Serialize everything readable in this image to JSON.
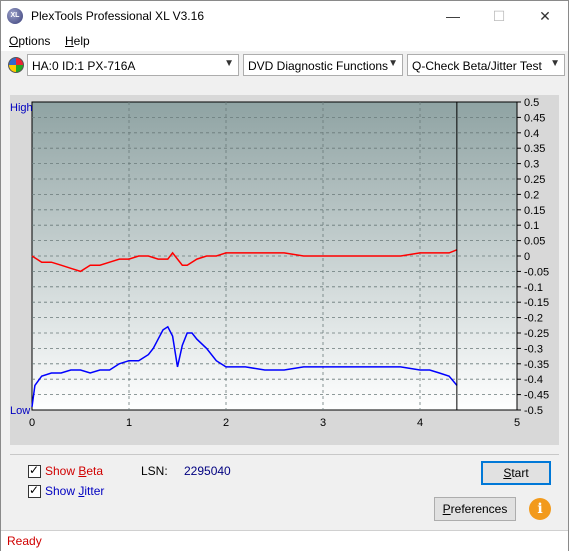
{
  "window": {
    "title": "PlexTools Professional XL V3.16",
    "icon_text": "XL"
  },
  "window_controls": {
    "minimize": "—",
    "maximize": "☐",
    "close": "✕"
  },
  "menu": [
    {
      "label": "Options",
      "ul": "O",
      "rest": "ptions"
    },
    {
      "label": "Help",
      "ul": "H",
      "rest": "elp"
    }
  ],
  "toolbar": {
    "drive": "HA:0 ID:1  PX-716A",
    "function": "DVD Diagnostic Functions",
    "test": "Q-Check Beta/Jitter Test"
  },
  "chart_data": {
    "type": "line",
    "x_ticks": [
      "0",
      "1",
      "2",
      "3",
      "4",
      "5"
    ],
    "xlim": [
      0,
      5
    ],
    "ylim": [
      -0.5,
      0.5
    ],
    "y_right_ticks": [
      "0.5",
      "0.45",
      "0.4",
      "0.35",
      "0.3",
      "0.25",
      "0.2",
      "0.15",
      "0.1",
      "0.05",
      "0",
      "-0.05",
      "-0.1",
      "-0.15",
      "-0.2",
      "-0.25",
      "-0.3",
      "-0.35",
      "-0.4",
      "-0.45",
      "-0.5"
    ],
    "y_left_labels": {
      "high": "High",
      "low": "Low"
    },
    "grid": true,
    "end_marker_x": 4.38,
    "colors": {
      "beta": "#ff0000",
      "jitter": "#0000ff",
      "plot_bg_top": "#8fa3a3",
      "plot_bg_bottom": "#ffffff"
    },
    "series": [
      {
        "name": "Beta",
        "x": [
          0,
          0.05,
          0.1,
          0.2,
          0.3,
          0.4,
          0.5,
          0.6,
          0.7,
          0.8,
          0.9,
          1.0,
          1.1,
          1.2,
          1.3,
          1.35,
          1.4,
          1.45,
          1.5,
          1.55,
          1.6,
          1.7,
          1.8,
          1.9,
          2.0,
          2.2,
          2.4,
          2.6,
          2.8,
          3.0,
          3.2,
          3.4,
          3.6,
          3.8,
          4.0,
          4.2,
          4.3,
          4.38
        ],
        "y": [
          0.0,
          -0.01,
          -0.02,
          -0.02,
          -0.03,
          -0.04,
          -0.05,
          -0.03,
          -0.03,
          -0.02,
          -0.01,
          -0.01,
          0.0,
          0.0,
          -0.01,
          -0.01,
          -0.01,
          0.01,
          -0.01,
          -0.03,
          -0.03,
          -0.01,
          0.0,
          0.0,
          0.01,
          0.01,
          0.01,
          0.01,
          0.0,
          0.0,
          0.0,
          0.0,
          0.0,
          0.0,
          0.01,
          0.01,
          0.01,
          0.02
        ]
      },
      {
        "name": "Jitter",
        "x": [
          0,
          0.03,
          0.1,
          0.2,
          0.3,
          0.4,
          0.5,
          0.6,
          0.7,
          0.8,
          0.9,
          1.0,
          1.1,
          1.2,
          1.25,
          1.3,
          1.35,
          1.4,
          1.45,
          1.5,
          1.55,
          1.6,
          1.65,
          1.7,
          1.8,
          1.9,
          2.0,
          2.2,
          2.4,
          2.6,
          2.8,
          3.0,
          3.2,
          3.4,
          3.6,
          3.8,
          4.0,
          4.1,
          4.2,
          4.3,
          4.38
        ],
        "y": [
          -0.49,
          -0.42,
          -0.39,
          -0.38,
          -0.38,
          -0.37,
          -0.37,
          -0.38,
          -0.37,
          -0.37,
          -0.35,
          -0.34,
          -0.34,
          -0.32,
          -0.3,
          -0.27,
          -0.24,
          -0.23,
          -0.26,
          -0.36,
          -0.29,
          -0.25,
          -0.25,
          -0.27,
          -0.3,
          -0.34,
          -0.36,
          -0.36,
          -0.37,
          -0.37,
          -0.36,
          -0.36,
          -0.36,
          -0.36,
          -0.36,
          -0.36,
          -0.37,
          -0.37,
          -0.38,
          -0.39,
          -0.42
        ]
      }
    ]
  },
  "options": {
    "show_beta": {
      "prefix": "Show ",
      "ul": "B",
      "rest": "eta",
      "color": "#d00000"
    },
    "show_jitter": {
      "prefix": "Show ",
      "ul": "J",
      "rest": "itter",
      "color": "#0000c0"
    }
  },
  "lsn": {
    "label": "LSN:",
    "value": "2295040"
  },
  "buttons": {
    "start": "Start",
    "start_ul": "S",
    "start_rest": "tart",
    "preferences": "Preferences",
    "pref_ul": "P",
    "pref_rest": "references",
    "info": "i"
  },
  "status": {
    "text": "Ready"
  }
}
